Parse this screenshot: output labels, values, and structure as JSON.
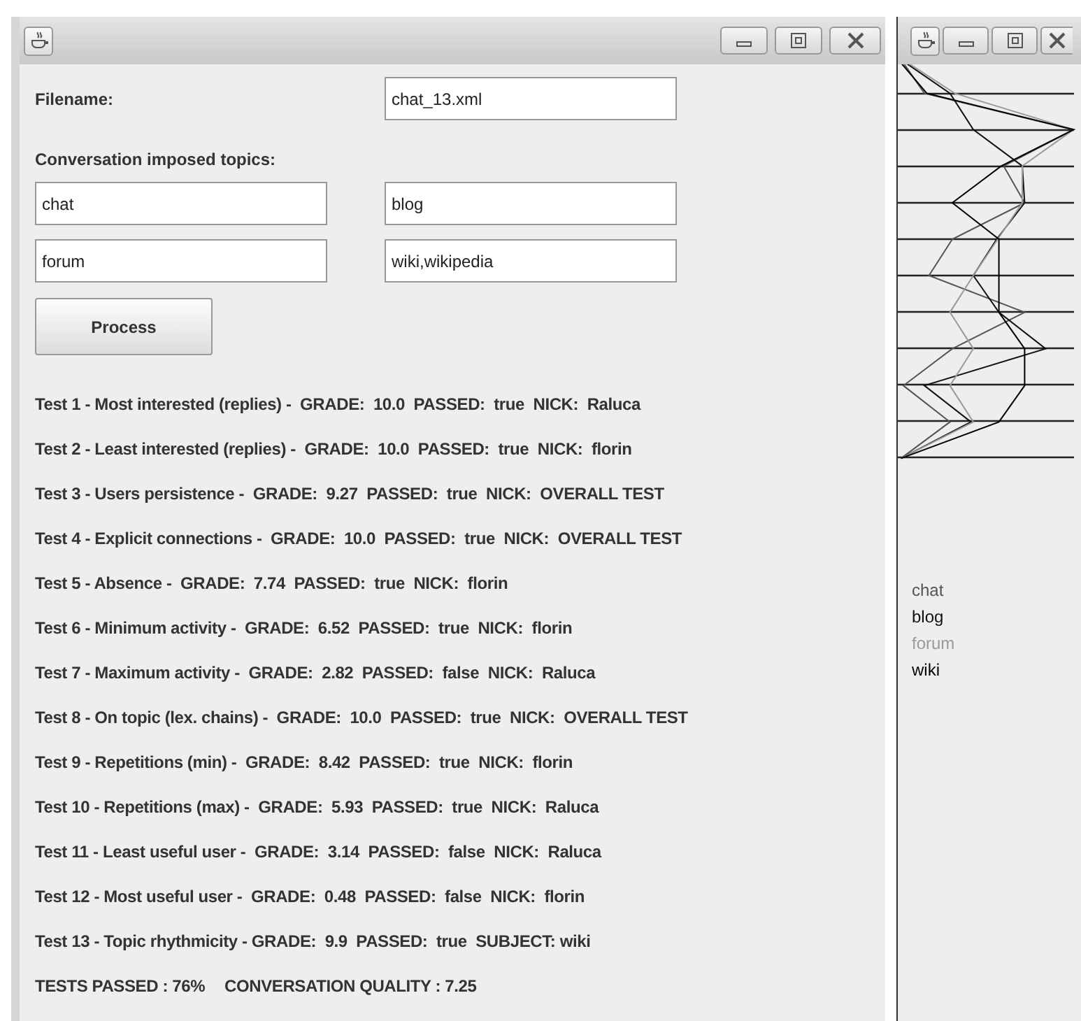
{
  "form": {
    "filename_label": "Filename:",
    "filename": "chat_13.xml",
    "topics_label": "Conversation imposed topics:",
    "topics": [
      "chat",
      "blog",
      "forum",
      "wiki,wikipedia"
    ],
    "process_button": "Process"
  },
  "results": [
    "Test 1 - Most interested (replies) -  GRADE:  10.0  PASSED:  true  NICK:  Raluca",
    "Test 2 - Least interested (replies) -  GRADE:  10.0  PASSED:  true  NICK:  florin",
    "Test 3 - Users persistence -  GRADE:  9.27  PASSED:  true  NICK:  OVERALL TEST",
    "Test 4 - Explicit connections -  GRADE:  10.0  PASSED:  true  NICK:  OVERALL TEST",
    "Test 5 - Absence -  GRADE:  7.74  PASSED:  true  NICK:  florin",
    "Test 6 - Minimum activity -  GRADE:  6.52  PASSED:  true  NICK:  florin",
    "Test 7 - Maximum activity -  GRADE:  2.82  PASSED:  false  NICK:  Raluca",
    "Test 8 - On topic (lex. chains) -  GRADE:  10.0  PASSED:  true  NICK:  OVERALL TEST",
    "Test 9 - Repetitions (min) -  GRADE:  8.42  PASSED:  true  NICK:  florin",
    "Test 10 - Repetitions (max) -  GRADE:  5.93  PASSED:  true  NICK:  Raluca",
    "Test 11 - Least useful user -  GRADE:  3.14  PASSED:  false  NICK:  Raluca",
    "Test 12 - Most useful user -  GRADE:  0.48  PASSED:  false  NICK:  florin",
    "Test 13 - Topic rhythmicity - GRADE:  9.9  PASSED:  true  SUBJECT: wiki"
  ],
  "summary": {
    "tests_passed": "TESTS PASSED : 76%",
    "quality": "CONVERSATION QUALITY : 7.25"
  },
  "topic_chart": {
    "legend": [
      {
        "label": "chat",
        "color": "#555555"
      },
      {
        "label": "blog",
        "color": "#111111"
      },
      {
        "label": "forum",
        "color": "#9a9a9a"
      },
      {
        "label": "wiki",
        "color": "#000000"
      }
    ]
  }
}
